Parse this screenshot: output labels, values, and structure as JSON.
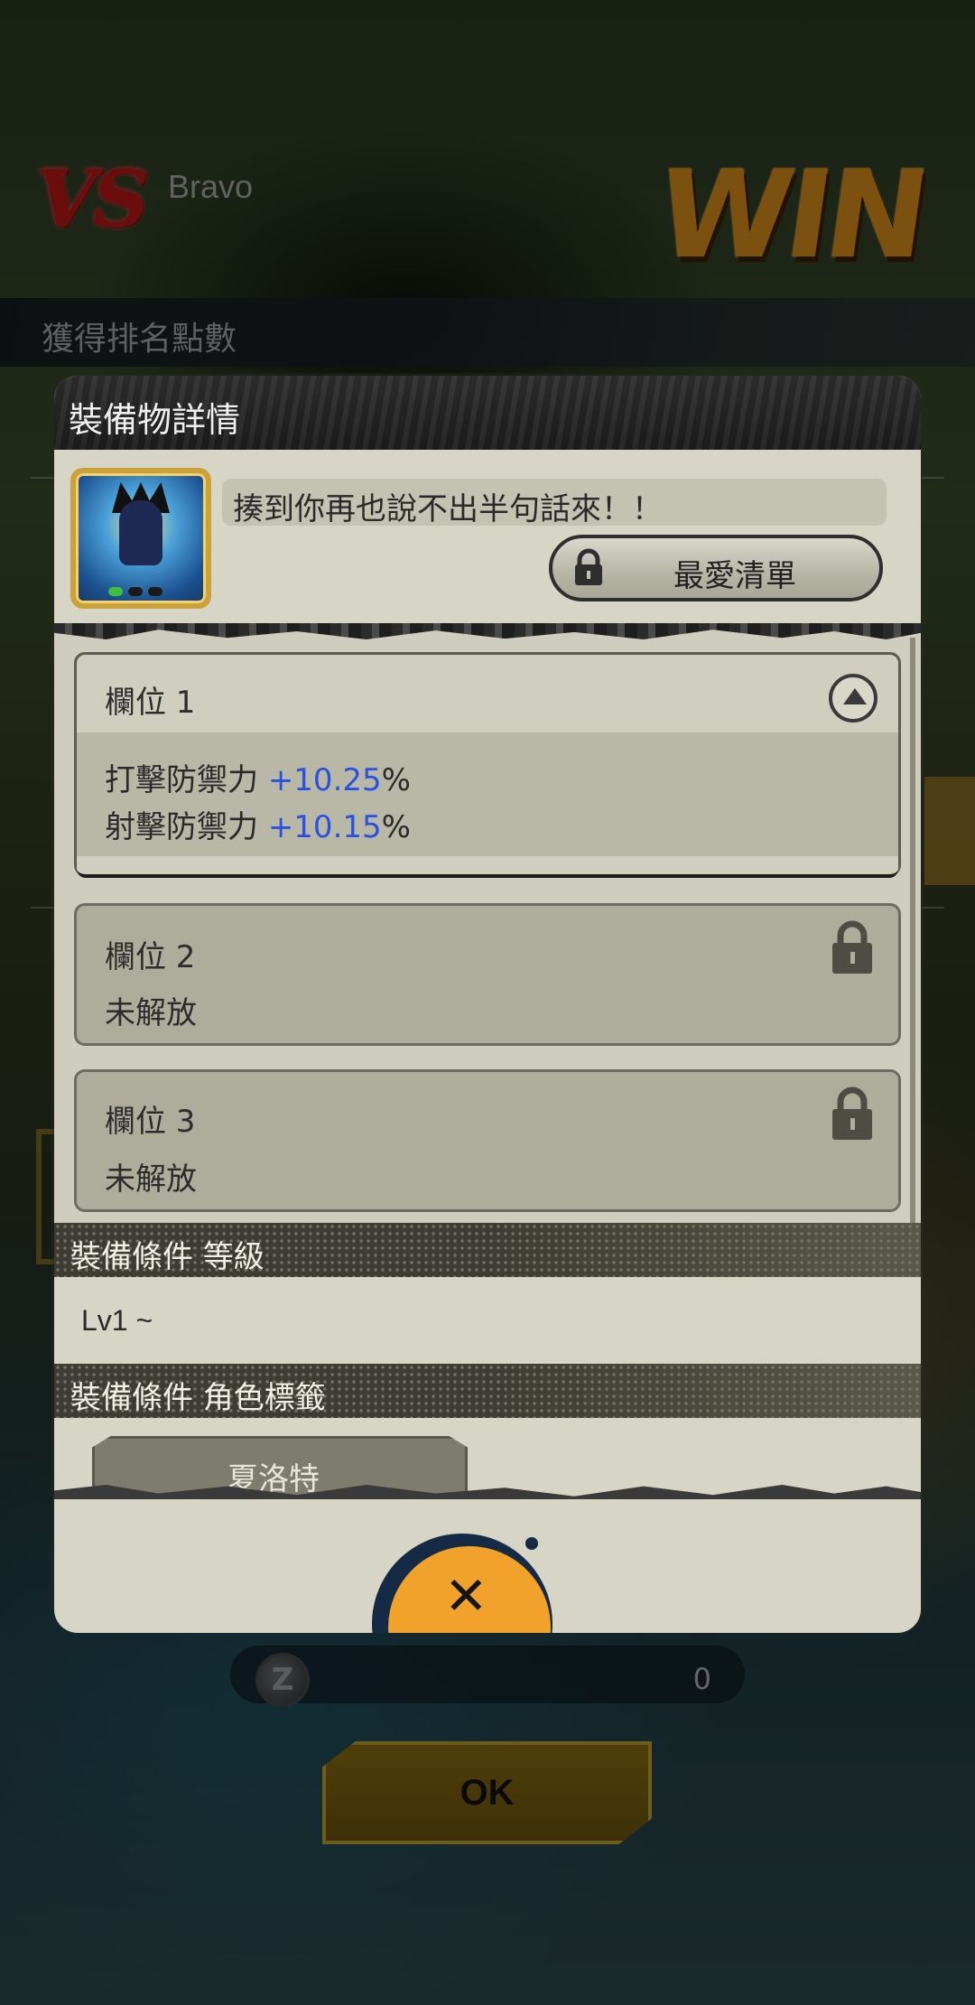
{
  "background": {
    "vs_logo": "VS",
    "opponent_name": "Bravo",
    "result": "WIN",
    "rank_points_label": "獲得排名點數",
    "coin_value": "0",
    "ok_label": "OK"
  },
  "modal": {
    "title": "裝備物詳情",
    "item_name": "揍到你再也說不出半句話來！！",
    "favorite_label": "最愛清單",
    "slots": [
      {
        "title": "欄位 1",
        "expanded": true,
        "stats": [
          {
            "name": "打擊防禦力",
            "value": "+10.25",
            "unit": "%"
          },
          {
            "name": "射擊防禦力",
            "value": "+10.15",
            "unit": "%"
          }
        ]
      },
      {
        "title": "欄位 2",
        "status": "未解放",
        "locked": true
      },
      {
        "title": "欄位 3",
        "status": "未解放",
        "locked": true
      }
    ],
    "level_section_title": "裝備條件 等級",
    "level_requirement": "Lv1 ~",
    "tag_section_title": "裝備條件 角色標籤",
    "tag": "夏洛特"
  },
  "colors": {
    "stat_value": "#2a52e0",
    "win_orange": "#d68a1a",
    "close_button": "#f1a22b"
  },
  "icons": [
    "lock-icon",
    "collapse-arrow-icon",
    "close-icon",
    "coin-icon"
  ]
}
